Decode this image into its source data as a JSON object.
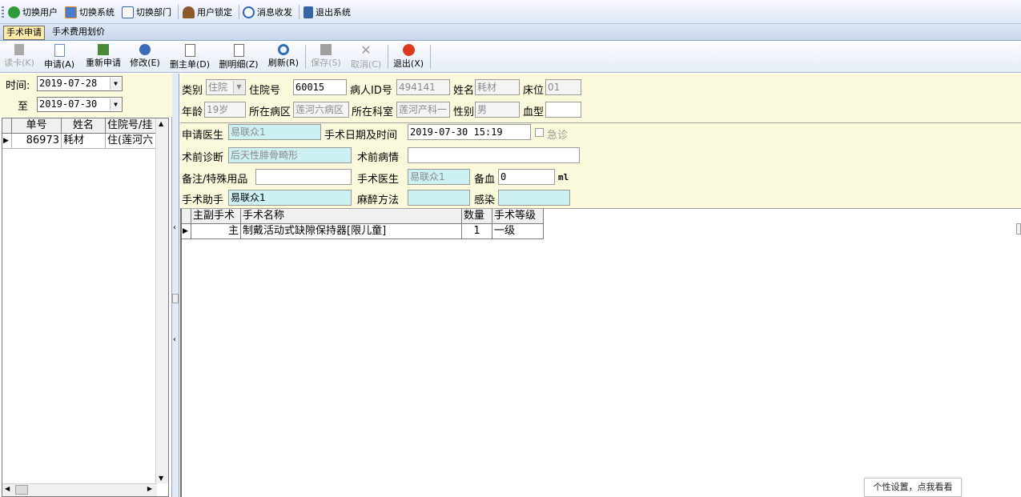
{
  "menu": {
    "items": [
      {
        "label": "切换用户",
        "icon": "users-switch-icon"
      },
      {
        "label": "切换系统",
        "icon": "system-switch-icon"
      },
      {
        "label": "切换部门",
        "icon": "department-switch-icon"
      },
      {
        "label": "用户锁定",
        "icon": "user-lock-icon"
      },
      {
        "label": "消息收发",
        "icon": "message-info-icon"
      },
      {
        "label": "退出系统",
        "icon": "exit-system-icon"
      }
    ]
  },
  "tabs": [
    {
      "label": "手术申请",
      "active": true
    },
    {
      "label": "手术费用划价",
      "active": false
    }
  ],
  "toolbar": {
    "read_card": "读卡(K)",
    "apply": "申请(A)",
    "reapply": "重新申请",
    "edit": "修改(E)",
    "delete_main": "删主单(D)",
    "delete_detail": "删明细(Z)",
    "refresh": "刷新(R)",
    "save": "保存(S)",
    "cancel": "取消(C)",
    "exit": "退出(X)"
  },
  "left": {
    "time_label": "时间:",
    "to_label": "至",
    "date_from": "2019-07-28",
    "date_to": "2019-07-30",
    "columns": [
      "单号",
      "姓名",
      "住院号/挂"
    ],
    "rows": [
      {
        "no": "86973",
        "name": "耗材",
        "inpatient": "住(莲河六"
      }
    ]
  },
  "form": {
    "category_label": "类别",
    "category_value": "住院",
    "inpatient_no_label": "住院号",
    "inpatient_no_value": "60015",
    "patient_id_label": "病人ID号",
    "patient_id_value": "494141",
    "name_label": "姓名",
    "name_value": "耗材",
    "bed_label": "床位",
    "bed_value": "01",
    "age_label": "年龄",
    "age_value": "19岁",
    "ward_label": "所在病区",
    "ward_value": "莲河六病区",
    "dept_label": "所在科室",
    "dept_value": "莲河产科一",
    "sex_label": "性别",
    "sex_value": "男",
    "blood_label": "血型",
    "blood_value": "",
    "doctor_label": "申请医生",
    "doctor_value": "易联众1",
    "datetime_label": "手术日期及时间",
    "datetime_value": "2019-07-30 15:19",
    "emergency_label": "急诊",
    "diagnosis_label": "术前诊断",
    "diagnosis_value": "后天性腓骨畸形",
    "condition_label": "术前病情",
    "condition_value": "",
    "remark_label": "备注/特殊用品",
    "remark_value": "",
    "surgeon_label": "手术医生",
    "surgeon_value": "易联众1",
    "blood_prep_label": "备血",
    "blood_prep_value": "0",
    "blood_unit": "ml",
    "assistant_label": "手术助手",
    "assistant_value": "易联众1",
    "anesthesia_label": "麻醉方法",
    "anesthesia_value": "",
    "infection_label": "感染",
    "infection_value": ""
  },
  "surgery_grid": {
    "columns": [
      "主副手术",
      "手术名称",
      "数量",
      "手术等级"
    ],
    "rows": [
      {
        "type": "主",
        "name": "制戴活动式缺隙保持器[限儿童]",
        "qty": "1",
        "level": "一级"
      }
    ]
  },
  "tooltip": "个性设置，点我看看",
  "colors": {
    "form_bg": "#fbf9dc",
    "readonly_cyan": "#cdf0f3",
    "active_tab": "#fde9a8",
    "exit_red": "#e03a1e"
  }
}
